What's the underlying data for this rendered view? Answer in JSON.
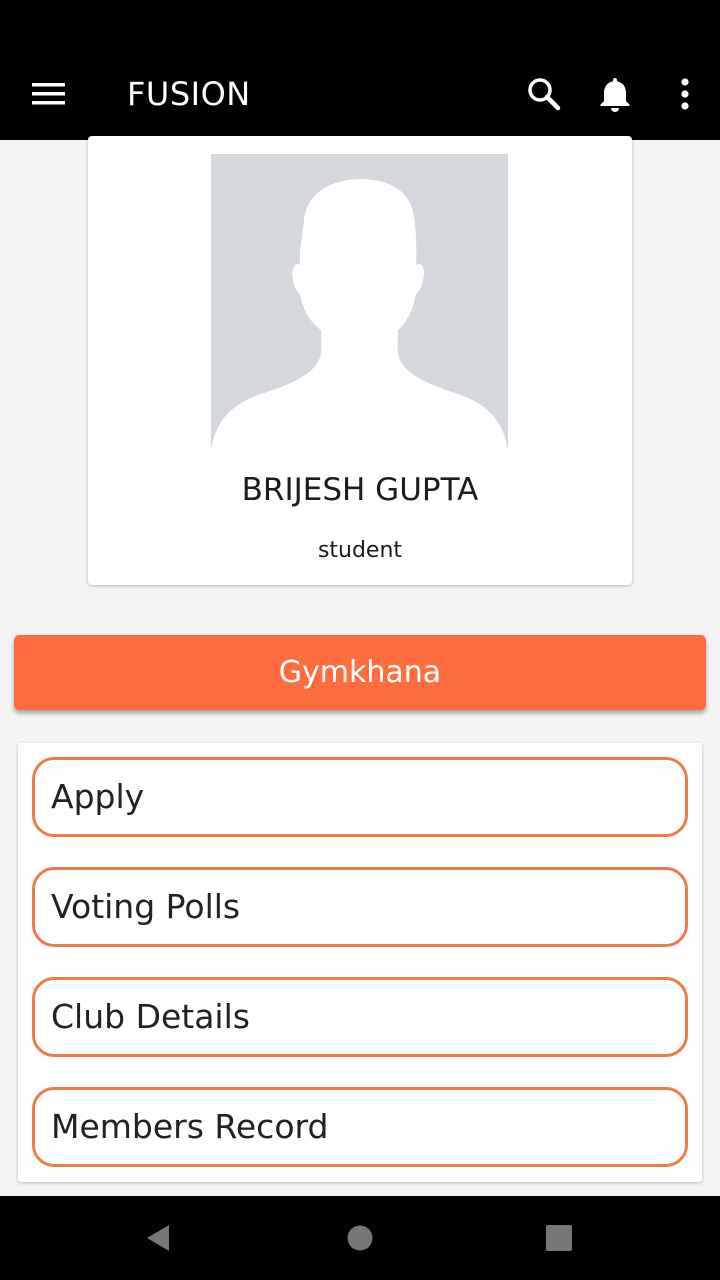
{
  "app_bar": {
    "title": "FUSION",
    "icons": [
      "menu-icon",
      "search-icon",
      "bell-icon",
      "more-vert-icon"
    ]
  },
  "profile": {
    "name": "BRIJESH GUPTA",
    "role": "student",
    "avatar": "default-avatar-silhouette"
  },
  "module": {
    "title": "Gymkhana"
  },
  "options": [
    {
      "label": "Apply"
    },
    {
      "label": "Voting Polls"
    },
    {
      "label": "Club Details"
    },
    {
      "label": "Members Record"
    }
  ],
  "nav_bar": {
    "icons": [
      "back-icon",
      "home-icon",
      "recents-icon"
    ]
  },
  "colors": {
    "accent": "#ff6d3f",
    "button_border": "#ee7a4e",
    "app_bar": "#000000",
    "background": "#f4f4f4",
    "avatar_bg": "#d4d7dc"
  }
}
